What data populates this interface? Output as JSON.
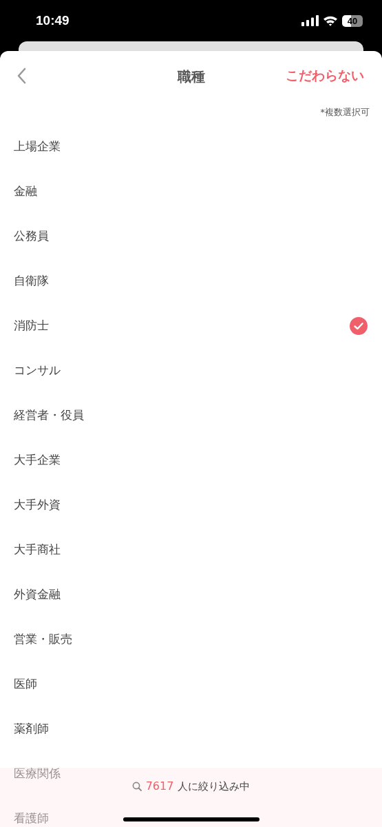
{
  "status_bar": {
    "time": "10:49",
    "battery": "40"
  },
  "header": {
    "title": "職種",
    "action": "こだわらない"
  },
  "note": "*複数選択可",
  "items": [
    {
      "label": "上場企業",
      "selected": false
    },
    {
      "label": "金融",
      "selected": false
    },
    {
      "label": "公務員",
      "selected": false
    },
    {
      "label": "自衛隊",
      "selected": false
    },
    {
      "label": "消防士",
      "selected": true
    },
    {
      "label": "コンサル",
      "selected": false
    },
    {
      "label": "経営者・役員",
      "selected": false
    },
    {
      "label": "大手企業",
      "selected": false
    },
    {
      "label": "大手外資",
      "selected": false
    },
    {
      "label": "大手商社",
      "selected": false
    },
    {
      "label": "外資金融",
      "selected": false
    },
    {
      "label": "営業・販売",
      "selected": false
    },
    {
      "label": "医師",
      "selected": false
    },
    {
      "label": "薬剤師",
      "selected": false
    },
    {
      "label": "医療関係",
      "selected": false
    },
    {
      "label": "看護師",
      "selected": false
    }
  ],
  "footer": {
    "count": "7617",
    "text": "人に絞り込み中"
  }
}
